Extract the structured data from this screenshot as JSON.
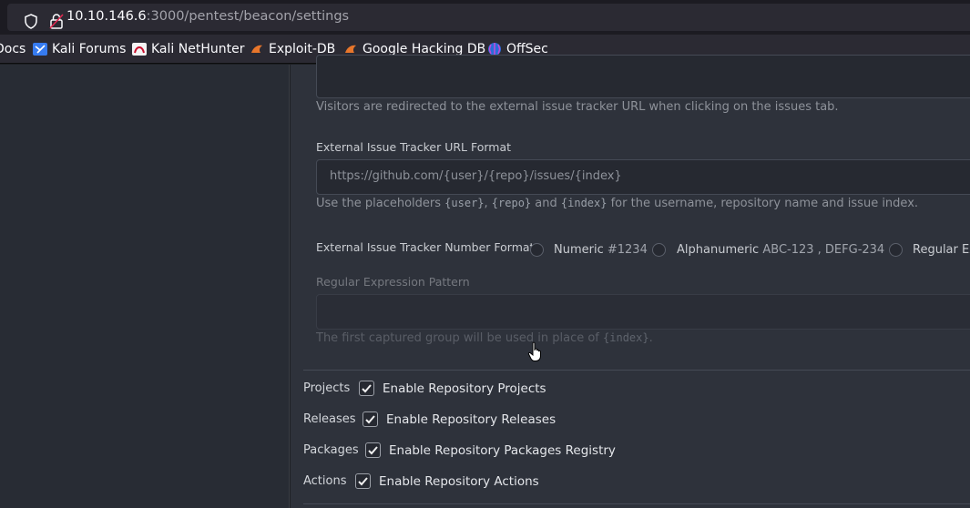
{
  "browser": {
    "url_host": "10.10.146.6",
    "url_rest": ":3000/pentest/beacon/settings",
    "bookmarks": [
      {
        "label": "Docs",
        "icon": "docs-icon"
      },
      {
        "label": "Kali Forums",
        "icon": "kali-icon"
      },
      {
        "label": "Kali NetHunter",
        "icon": "nethunter-icon"
      },
      {
        "label": "Exploit-DB",
        "icon": "exploitdb-icon"
      },
      {
        "label": "Google Hacking DB",
        "icon": "ghdb-icon"
      },
      {
        "label": "OffSec",
        "icon": "offsec-icon"
      }
    ]
  },
  "tracker": {
    "redirect_help": "Visitors are redirected to the external issue tracker URL when clicking on the issues tab.",
    "url_format_label": "External Issue Tracker URL Format",
    "url_format_placeholder": "https://github.com/{user}/{repo}/issues/{index}",
    "placeholders_help_1": "Use the placeholders ",
    "placeholders_help_code1": "{user}",
    "placeholders_help_2": ", ",
    "placeholders_help_code2": "{repo}",
    "placeholders_help_3": " and ",
    "placeholders_help_code3": "{index}",
    "placeholders_help_4": " for the username, repository name and issue index.",
    "number_format_label": "External Issue Tracker Number Format",
    "radio_numeric_label": "Numeric",
    "radio_numeric_example": "#1234",
    "radio_alnum_label": "Alphanumeric",
    "radio_alnum_example": "ABC-123 , DEFG-234",
    "radio_regex_label": "Regular Ex",
    "regex_label": "Regular Expression Pattern",
    "regex_help_1": "The first captured group will be used in place of ",
    "regex_help_code": "{index}",
    "regex_help_2": "."
  },
  "units": [
    {
      "label": "Projects",
      "checkbox": "Enable Repository Projects",
      "checked": true
    },
    {
      "label": "Releases",
      "checkbox": "Enable Repository Releases",
      "checked": true
    },
    {
      "label": "Packages",
      "checkbox": "Enable Repository Packages Registry",
      "checked": true
    },
    {
      "label": "Actions",
      "checkbox": "Enable Repository Actions",
      "checked": true
    }
  ]
}
